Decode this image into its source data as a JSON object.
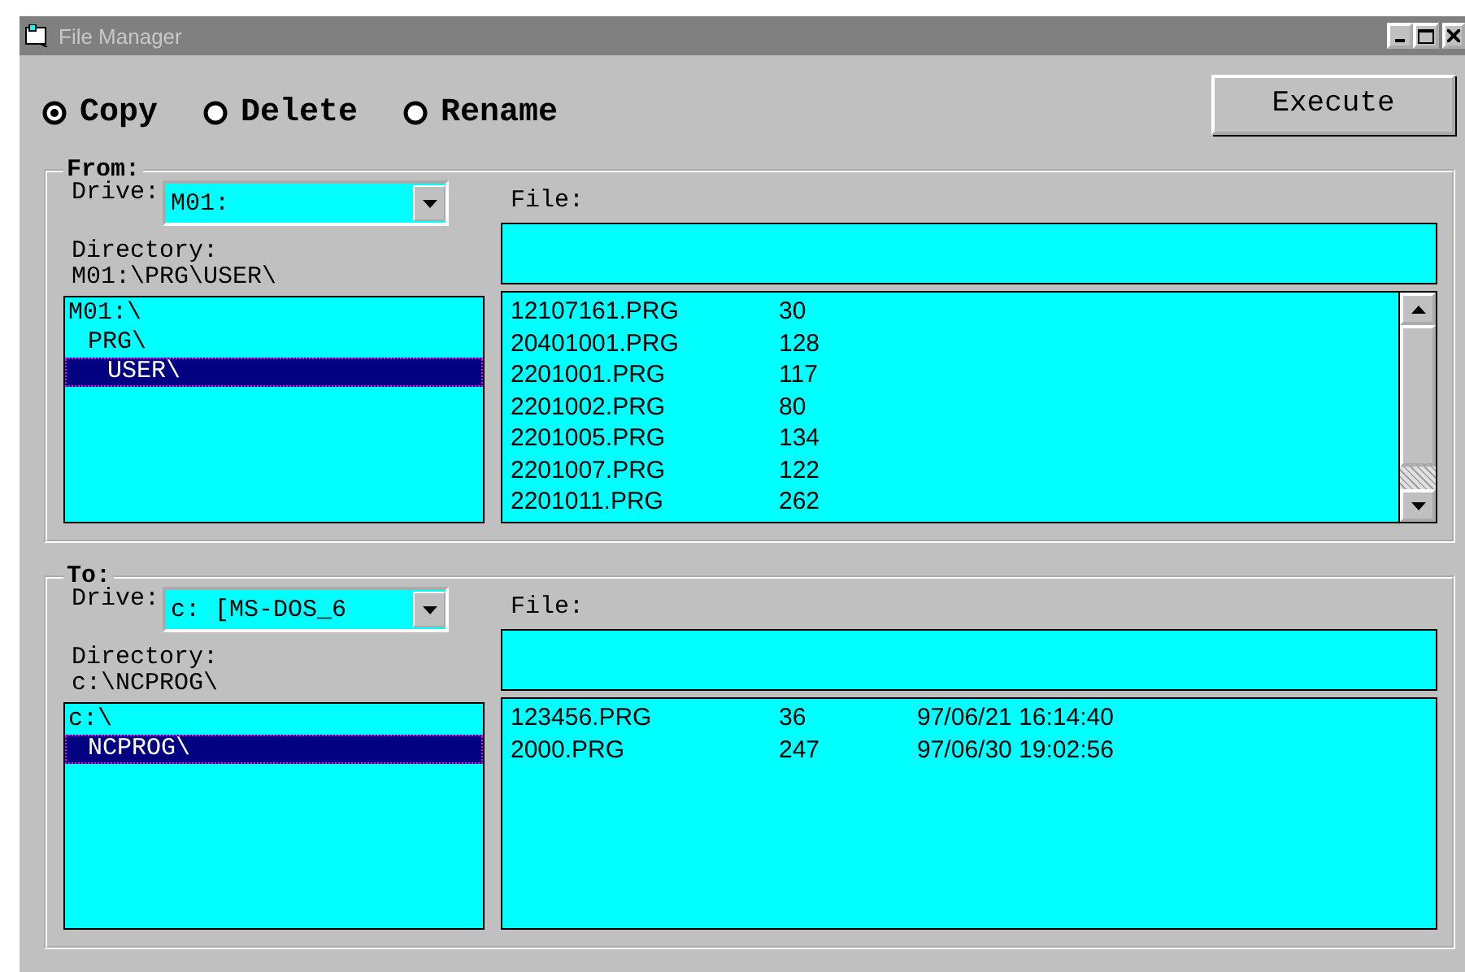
{
  "window": {
    "title": "File Manager"
  },
  "operations": [
    {
      "label": "Copy",
      "selected": true
    },
    {
      "label": "Delete",
      "selected": false
    },
    {
      "label": "Rename",
      "selected": false
    }
  ],
  "execute_button": "Execute",
  "panels": [
    {
      "title": "From:",
      "drive_label": "Drive:",
      "drive": "M01:",
      "directory_label": "Directory:",
      "directory_path": "M01:\\PRG\\USER\\",
      "tree": [
        {
          "label": "M01:\\",
          "selected": false,
          "children": [
            {
              "label": "PRG\\",
              "selected": false,
              "children": [
                {
                  "label": "USER\\",
                  "selected": true
                }
              ]
            }
          ]
        }
      ],
      "file_label": "File:",
      "has_scrollbar": true,
      "files": [
        {
          "cells": [
            "12107161.PRG",
            "30"
          ]
        },
        {
          "cells": [
            "20401001.PRG",
            "128"
          ]
        },
        {
          "cells": [
            "2201001.PRG",
            "117"
          ]
        },
        {
          "cells": [
            "2201002.PRG",
            "80"
          ]
        },
        {
          "cells": [
            "2201005.PRG",
            "134"
          ]
        },
        {
          "cells": [
            "2201007.PRG",
            "122"
          ]
        },
        {
          "cells": [
            "2201011.PRG",
            "262"
          ]
        }
      ]
    },
    {
      "title": "To:",
      "drive_label": "Drive:",
      "drive": "c: [MS-DOS_6",
      "directory_label": "Directory:",
      "directory_path": "c:\\NCPROG\\",
      "tree": [
        {
          "label": "c:\\",
          "selected": false,
          "children": [
            {
              "label": "NCPROG\\",
              "selected": true
            }
          ]
        }
      ],
      "file_label": "File:",
      "has_scrollbar": false,
      "files": [
        {
          "cells": [
            "123456.PRG",
            "36",
            "97/06/21 16:14:40"
          ]
        },
        {
          "cells": [
            "2000.PRG",
            "247",
            "97/06/30 19:02:56"
          ]
        }
      ]
    }
  ]
}
